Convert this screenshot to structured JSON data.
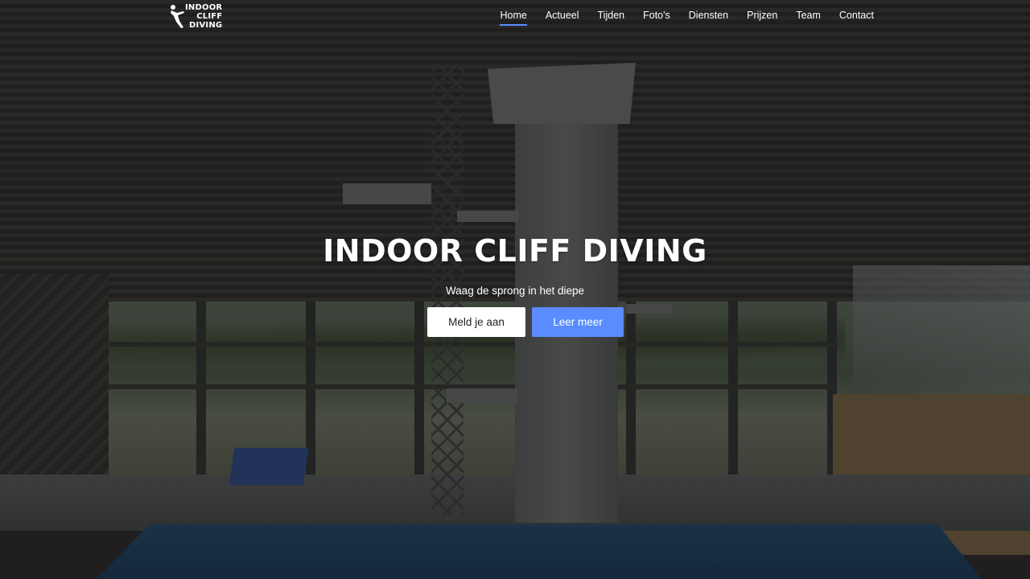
{
  "brand": {
    "logo_lines": [
      "INDOOR",
      "CLIFF",
      "DIVING"
    ]
  },
  "nav": {
    "items": [
      {
        "label": "Home",
        "active": true
      },
      {
        "label": "Actueel",
        "active": false
      },
      {
        "label": "Tijden",
        "active": false
      },
      {
        "label": "Foto's",
        "active": false
      },
      {
        "label": "Diensten",
        "active": false
      },
      {
        "label": "Prijzen",
        "active": false
      },
      {
        "label": "Team",
        "active": false
      },
      {
        "label": "Contact",
        "active": false
      }
    ]
  },
  "hero": {
    "title": "INDOOR CLIFF DIVING",
    "subtitle": "Waag de sprong in het diepe",
    "primary_button": "Meld je aan",
    "secondary_button": "Leer meer",
    "background_image": "indoor-diving-pool-with-tower"
  },
  "colors": {
    "accent": "#5b8cff",
    "primary_button_bg": "#ffffff",
    "text": "#ffffff"
  }
}
